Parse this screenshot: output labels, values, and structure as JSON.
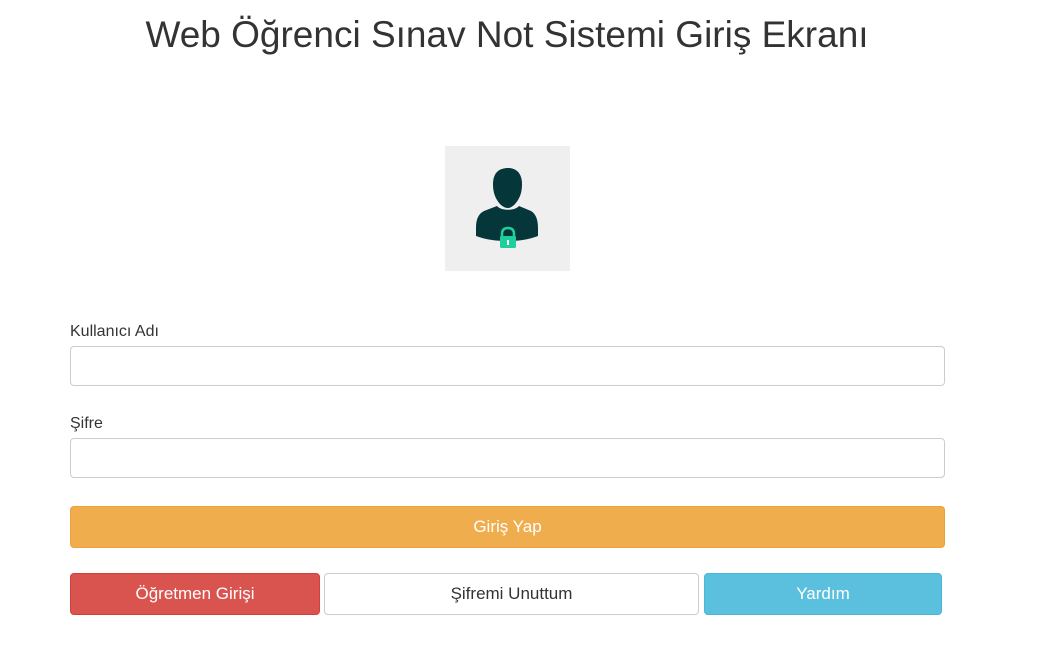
{
  "header": {
    "title": "Web Öğrenci Sınav Not Sistemi Giriş Ekranı"
  },
  "avatar": {
    "icon": "user-lock-icon",
    "colors": {
      "silhouette": "#05363a",
      "lock": "#1fcf9b",
      "background": "#efefef"
    }
  },
  "form": {
    "username_label": "Kullanıcı Adı",
    "username_value": "",
    "password_label": "Şifre",
    "password_value": "",
    "login_button": "Giriş Yap"
  },
  "actions": {
    "teacher_login": "Öğretmen Girişi",
    "forgot_password": "Şifremi Unuttum",
    "help": "Yardım"
  },
  "colors": {
    "warning": "#f0ad4e",
    "danger": "#d9534f",
    "info": "#5bc0de"
  }
}
